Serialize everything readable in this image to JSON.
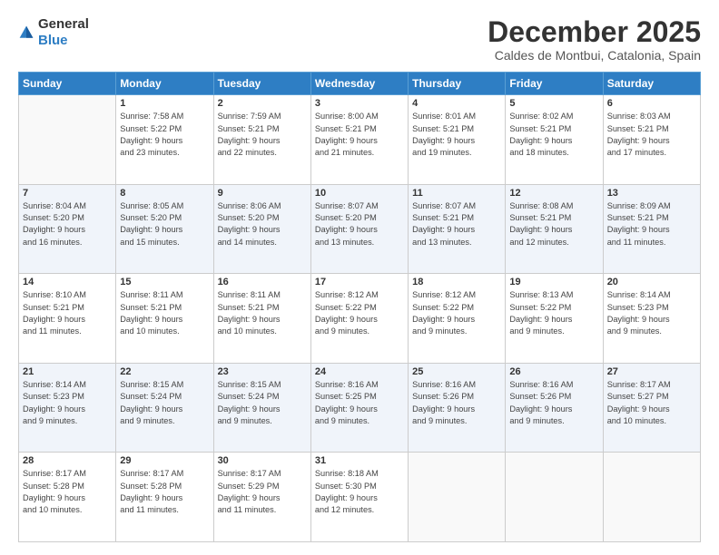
{
  "logo": {
    "general": "General",
    "blue": "Blue"
  },
  "header": {
    "month": "December 2025",
    "location": "Caldes de Montbui, Catalonia, Spain"
  },
  "weekdays": [
    "Sunday",
    "Monday",
    "Tuesday",
    "Wednesday",
    "Thursday",
    "Friday",
    "Saturday"
  ],
  "weeks": [
    [
      {
        "day": "",
        "info": ""
      },
      {
        "day": "1",
        "info": "Sunrise: 7:58 AM\nSunset: 5:22 PM\nDaylight: 9 hours\nand 23 minutes."
      },
      {
        "day": "2",
        "info": "Sunrise: 7:59 AM\nSunset: 5:21 PM\nDaylight: 9 hours\nand 22 minutes."
      },
      {
        "day": "3",
        "info": "Sunrise: 8:00 AM\nSunset: 5:21 PM\nDaylight: 9 hours\nand 21 minutes."
      },
      {
        "day": "4",
        "info": "Sunrise: 8:01 AM\nSunset: 5:21 PM\nDaylight: 9 hours\nand 19 minutes."
      },
      {
        "day": "5",
        "info": "Sunrise: 8:02 AM\nSunset: 5:21 PM\nDaylight: 9 hours\nand 18 minutes."
      },
      {
        "day": "6",
        "info": "Sunrise: 8:03 AM\nSunset: 5:21 PM\nDaylight: 9 hours\nand 17 minutes."
      }
    ],
    [
      {
        "day": "7",
        "info": "Sunrise: 8:04 AM\nSunset: 5:20 PM\nDaylight: 9 hours\nand 16 minutes."
      },
      {
        "day": "8",
        "info": "Sunrise: 8:05 AM\nSunset: 5:20 PM\nDaylight: 9 hours\nand 15 minutes."
      },
      {
        "day": "9",
        "info": "Sunrise: 8:06 AM\nSunset: 5:20 PM\nDaylight: 9 hours\nand 14 minutes."
      },
      {
        "day": "10",
        "info": "Sunrise: 8:07 AM\nSunset: 5:20 PM\nDaylight: 9 hours\nand 13 minutes."
      },
      {
        "day": "11",
        "info": "Sunrise: 8:07 AM\nSunset: 5:21 PM\nDaylight: 9 hours\nand 13 minutes."
      },
      {
        "day": "12",
        "info": "Sunrise: 8:08 AM\nSunset: 5:21 PM\nDaylight: 9 hours\nand 12 minutes."
      },
      {
        "day": "13",
        "info": "Sunrise: 8:09 AM\nSunset: 5:21 PM\nDaylight: 9 hours\nand 11 minutes."
      }
    ],
    [
      {
        "day": "14",
        "info": "Sunrise: 8:10 AM\nSunset: 5:21 PM\nDaylight: 9 hours\nand 11 minutes."
      },
      {
        "day": "15",
        "info": "Sunrise: 8:11 AM\nSunset: 5:21 PM\nDaylight: 9 hours\nand 10 minutes."
      },
      {
        "day": "16",
        "info": "Sunrise: 8:11 AM\nSunset: 5:21 PM\nDaylight: 9 hours\nand 10 minutes."
      },
      {
        "day": "17",
        "info": "Sunrise: 8:12 AM\nSunset: 5:22 PM\nDaylight: 9 hours\nand 9 minutes."
      },
      {
        "day": "18",
        "info": "Sunrise: 8:12 AM\nSunset: 5:22 PM\nDaylight: 9 hours\nand 9 minutes."
      },
      {
        "day": "19",
        "info": "Sunrise: 8:13 AM\nSunset: 5:22 PM\nDaylight: 9 hours\nand 9 minutes."
      },
      {
        "day": "20",
        "info": "Sunrise: 8:14 AM\nSunset: 5:23 PM\nDaylight: 9 hours\nand 9 minutes."
      }
    ],
    [
      {
        "day": "21",
        "info": "Sunrise: 8:14 AM\nSunset: 5:23 PM\nDaylight: 9 hours\nand 9 minutes."
      },
      {
        "day": "22",
        "info": "Sunrise: 8:15 AM\nSunset: 5:24 PM\nDaylight: 9 hours\nand 9 minutes."
      },
      {
        "day": "23",
        "info": "Sunrise: 8:15 AM\nSunset: 5:24 PM\nDaylight: 9 hours\nand 9 minutes."
      },
      {
        "day": "24",
        "info": "Sunrise: 8:16 AM\nSunset: 5:25 PM\nDaylight: 9 hours\nand 9 minutes."
      },
      {
        "day": "25",
        "info": "Sunrise: 8:16 AM\nSunset: 5:26 PM\nDaylight: 9 hours\nand 9 minutes."
      },
      {
        "day": "26",
        "info": "Sunrise: 8:16 AM\nSunset: 5:26 PM\nDaylight: 9 hours\nand 9 minutes."
      },
      {
        "day": "27",
        "info": "Sunrise: 8:17 AM\nSunset: 5:27 PM\nDaylight: 9 hours\nand 10 minutes."
      }
    ],
    [
      {
        "day": "28",
        "info": "Sunrise: 8:17 AM\nSunset: 5:28 PM\nDaylight: 9 hours\nand 10 minutes."
      },
      {
        "day": "29",
        "info": "Sunrise: 8:17 AM\nSunset: 5:28 PM\nDaylight: 9 hours\nand 11 minutes."
      },
      {
        "day": "30",
        "info": "Sunrise: 8:17 AM\nSunset: 5:29 PM\nDaylight: 9 hours\nand 11 minutes."
      },
      {
        "day": "31",
        "info": "Sunrise: 8:18 AM\nSunset: 5:30 PM\nDaylight: 9 hours\nand 12 minutes."
      },
      {
        "day": "",
        "info": ""
      },
      {
        "day": "",
        "info": ""
      },
      {
        "day": "",
        "info": ""
      }
    ]
  ]
}
